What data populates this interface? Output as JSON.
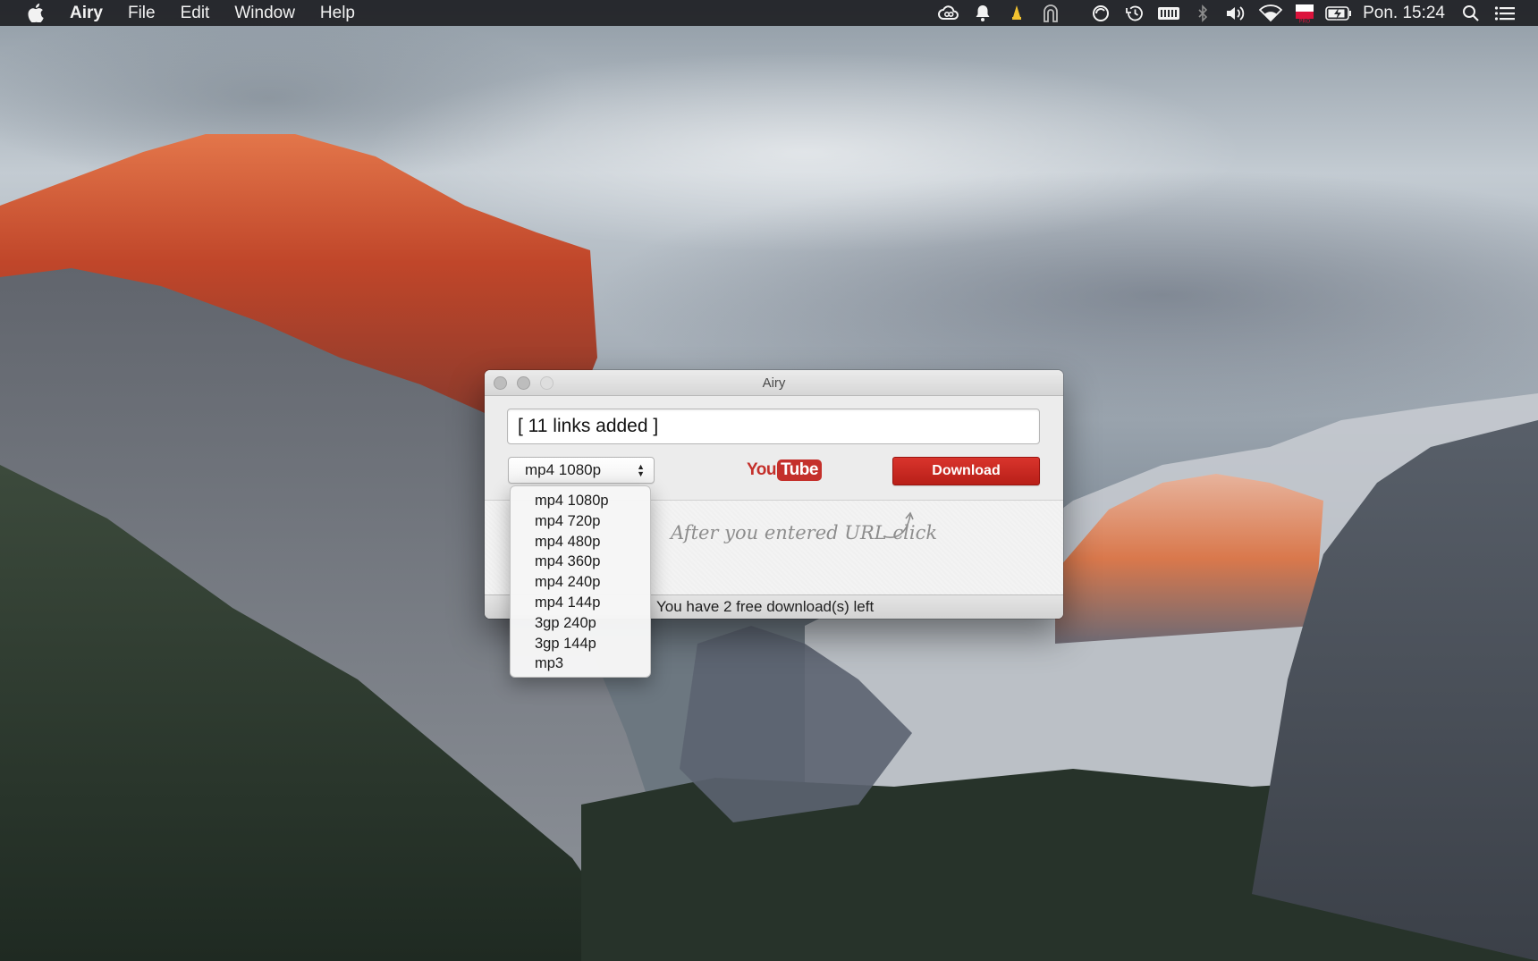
{
  "menubar": {
    "app_name": "Airy",
    "items": [
      "File",
      "Edit",
      "Window",
      "Help"
    ],
    "clock": "Pon. 15:24"
  },
  "window": {
    "title": "Airy",
    "url_input_value": "[ 11 links added ]",
    "format_selected": "mp4 1080p",
    "youtube_you": "You",
    "youtube_tube": "Tube",
    "download_label": "Download",
    "hint": "After you entered URL click",
    "status": "You have 2 free download(s) left"
  },
  "dropdown": {
    "options": [
      "mp4 1080p",
      "mp4 720p",
      "mp4 480p",
      "mp4 360p",
      "mp4 240p",
      "mp4 144p",
      "3gp 240p",
      "3gp 144p",
      "mp3"
    ]
  },
  "colors": {
    "menubar_bg": "#1e2024",
    "download_red": "#c4271f",
    "youtube_red": "#c4302b"
  }
}
